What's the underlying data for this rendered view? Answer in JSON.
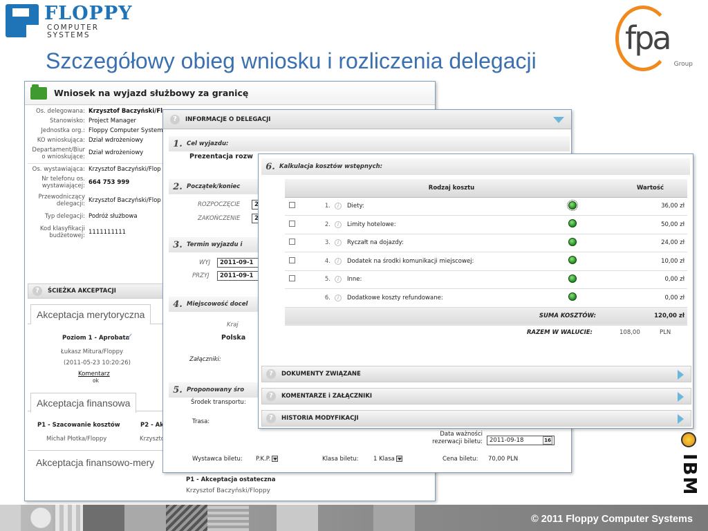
{
  "header": {
    "logo_main": "FLOPPY",
    "logo_line1": "COMPUTER",
    "logo_line2": "SYSTEMS",
    "fpa_word": "fpa",
    "fpa_group": "Group",
    "slide_title": "Szczegółowy obieg wniosku i rozliczenia delegacji"
  },
  "form": {
    "title": "Wniosek na wyjazd służbowy za granicę",
    "fields": [
      {
        "label": "Os. delegowana:",
        "value": "Krzysztof Baczyński/Flop",
        "bold": true
      },
      {
        "label": "Stanowisko:",
        "value": "Project Manager"
      },
      {
        "label": "Jednostka org.:",
        "value": "Floppy Computer System"
      },
      {
        "label": "KO wnioskująca:",
        "value": "Dział wdrożeniowy"
      },
      {
        "label": "Departament/Biur o wnioskujące:",
        "value": "Dział wdrożeniowy"
      },
      {
        "label": "Os. wystawiająca:",
        "value": "Krzysztof Baczyński/Flop"
      },
      {
        "label": "Nr telefonu os. wystawiającej:",
        "value": "664 753 999",
        "bold": true
      },
      {
        "label": "Przewodniczący delegacji:",
        "value": "Krzysztof Baczyński/Flop"
      },
      {
        "label": "Typ delegacji:",
        "value": "Podróż służbowa"
      },
      {
        "label": "Kod klasyfikacji budżetowej:",
        "value": "1111111111"
      }
    ],
    "path_section": "ŚCIEŻKA AKCEPTACJI",
    "acc1": {
      "tab": "Akceptacja merytoryczna",
      "level": "Poziom 1 - Aprobata",
      "person": "Łukasz Mitura/Floppy",
      "date": "(2011-05-23 10:20:26)",
      "comment_link": "Komentarz",
      "ok": "ok"
    },
    "acc2": {
      "tab": "Akceptacja finansowa",
      "p1": "P1 - Szacowanie kosztów",
      "p2": "P2 - Ak",
      "person1": "Michał Płotka/Floppy",
      "person2": "Krzysztof"
    },
    "acc3": {
      "tab": "Akceptacja finansowo-mery",
      "final": "P1 - Akceptacja ostateczna",
      "final_person": "Krzysztof Baczyński/Floppy"
    }
  },
  "delegation": {
    "header": "INFORMACJE O DELEGACJI",
    "s1_num": "1.",
    "s1_title": "Cel wyjazdu:",
    "s1_value": "Prezentacja rozw",
    "s2_num": "2.",
    "s2_title": "Początek/koniec",
    "start_label": "ROZPOCZĘCIE",
    "start_value": "2",
    "end_label": "ZAKOŃCZENIE",
    "end_value": "2",
    "s3_num": "3.",
    "s3_title": "Termin wyjazdu i",
    "wyj_label": "WYJ",
    "wyj_value": "2011-09-1",
    "przyj_label": "PRZYJ",
    "przyj_value": "2011-09-1",
    "s4_num": "4.",
    "s4_title": "Miejscowość docel",
    "kraj_label": "Kraj",
    "kraj_value": "Polska",
    "attachments_label": "Załączniki:",
    "s5_num": "5.",
    "s5_title": "Proponowany śro",
    "transport_label": "Środek transportu:",
    "route_label": "Trasa:",
    "validity_label": "Data ważności rezerwacji biletu:",
    "validity_value": "2011-09-18",
    "calendar_label": "16",
    "issuer_label": "Wystawca biletu:",
    "issuer_value": "P.K.P.",
    "class_label": "Klasa biletu:",
    "class_value": "1 Klasa",
    "price_label": "Cena biletu:",
    "price_value": "70,00",
    "price_currency": "PLN"
  },
  "costs": {
    "num": "6.",
    "title": "Kalkulacja kosztów wstępnych:",
    "col_type": "Rodzaj kosztu",
    "col_value": "Wartość",
    "rows": [
      {
        "n": "1.",
        "label": "Diety:",
        "amount": "36,00 zł"
      },
      {
        "n": "2.",
        "label": "Limity hotelowe:",
        "amount": "50,00 zł"
      },
      {
        "n": "3.",
        "label": "Ryczałt na dojazdy:",
        "amount": "24,00 zł"
      },
      {
        "n": "4.",
        "label": "Dodatek na środki komunikacji miejscowej:",
        "amount": "10,00 zł"
      },
      {
        "n": "5.",
        "label": "Inne:",
        "amount": "0,00 zł"
      },
      {
        "n": "6.",
        "label": "Dodatkowe koszty refundowane:",
        "amount": "0,00 zł"
      }
    ],
    "sum_label": "SUMA KOSZTÓW:",
    "sum_value": "120,00 zł",
    "currency_label": "RAZEM W WALUCIE:",
    "currency_value": "108,00",
    "currency_code": "PLN",
    "docs": "DOKUMENTY ZWIĄZANE",
    "comments": "KOMENTARZE i ZAŁĄCZNIKI",
    "history": "HISTORIA MODYFIKACJI"
  },
  "footer": {
    "copyright": "© 2011 Floppy Computer Systems",
    "ibm": "IBM"
  },
  "colors": {
    "title_blue": "#3a6fb0",
    "logo_blue": "#1f73b7",
    "fpa_orange": "#f08a1c",
    "status_green": "#1f8a1f"
  }
}
